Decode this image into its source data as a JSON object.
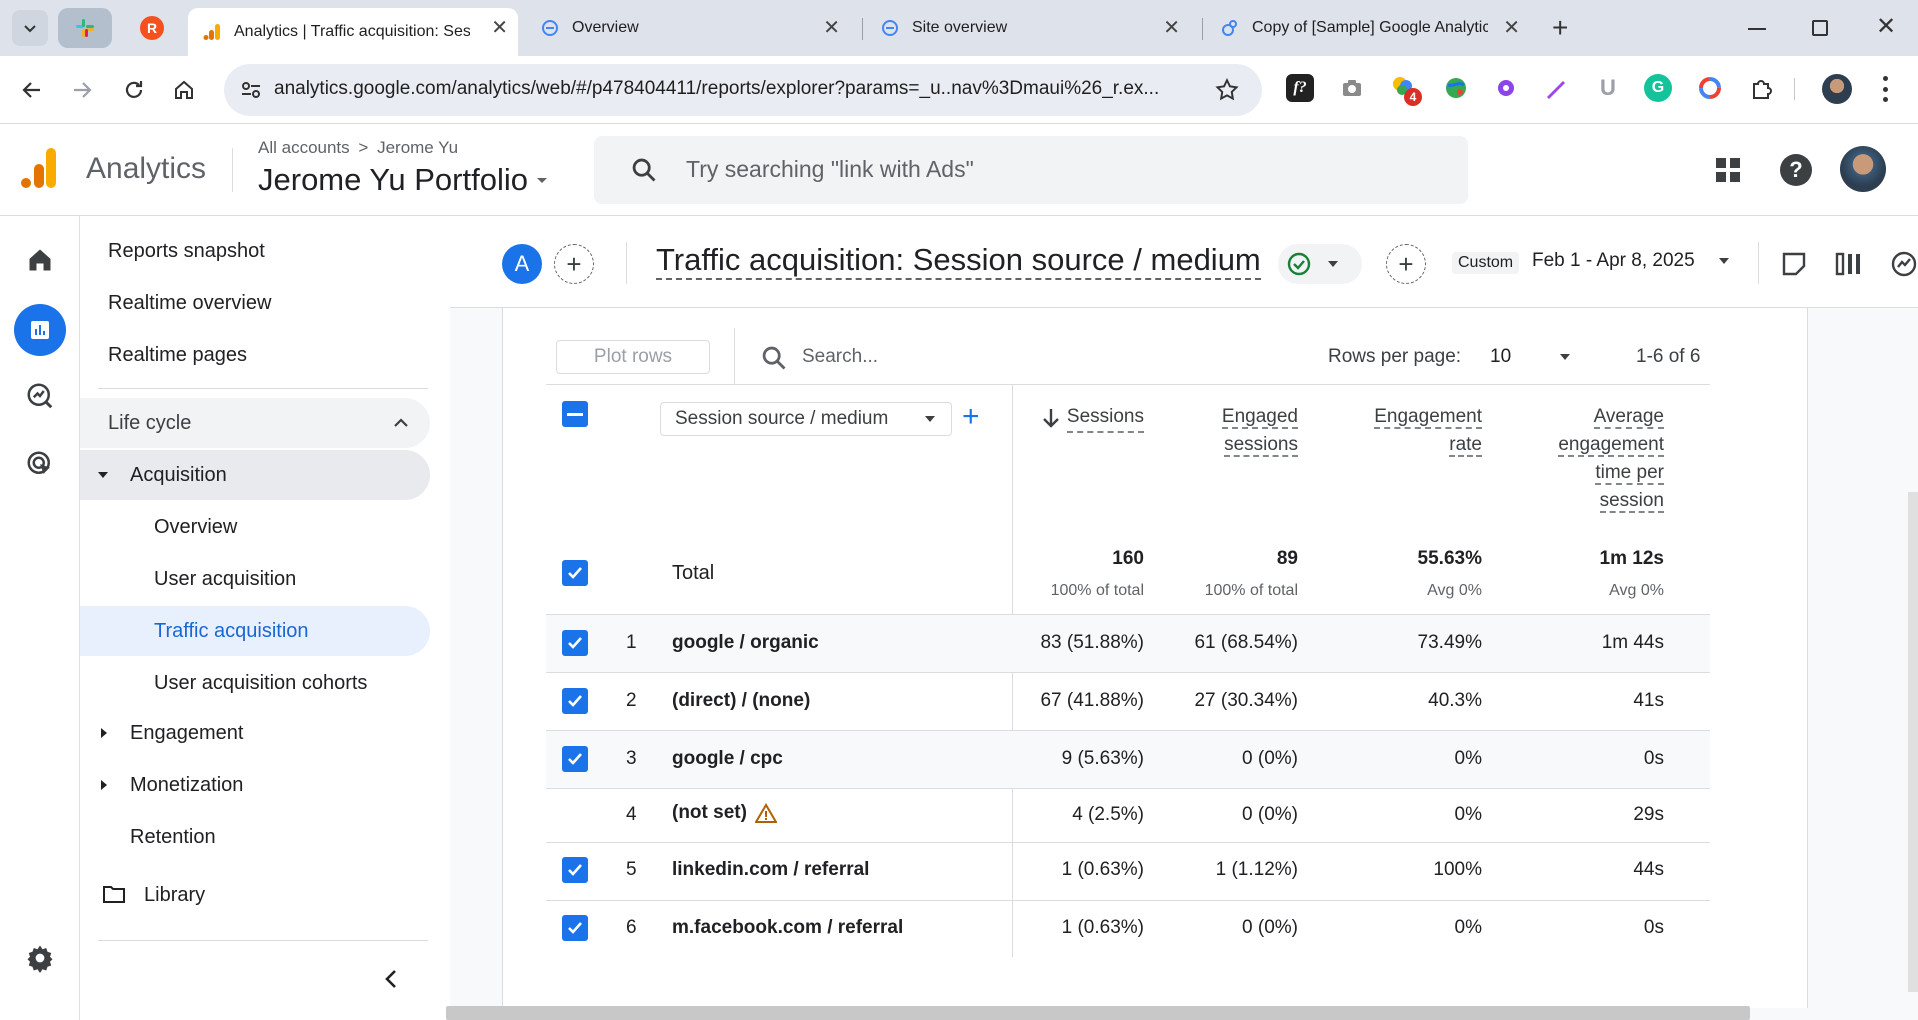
{
  "browser": {
    "tabs": [
      {
        "title": "Analytics | Traffic acquisition: Session source / medium",
        "active": true
      },
      {
        "title": "Overview",
        "active": false
      },
      {
        "title": "Site overview",
        "active": false
      },
      {
        "title": "Copy of [Sample] Google Analytics",
        "active": false
      }
    ],
    "url": "analytics.google.com/analytics/web/#/p478404411/reports/explorer?params=_u..nav%3Dmaui%26_r.ex...",
    "extension_badge": "4"
  },
  "header": {
    "product": "Analytics",
    "breadcrumb_all": "All accounts",
    "breadcrumb_sep": ">",
    "breadcrumb_account": "Jerome Yu",
    "property": "Jerome Yu Portfolio",
    "search_placeholder": "Try searching \"link with Ads\""
  },
  "nav": {
    "top": [
      "Reports snapshot",
      "Realtime overview",
      "Realtime pages"
    ],
    "lifecycle": "Life cycle",
    "acquisition": "Acquisition",
    "acquisition_items": [
      "Overview",
      "User acquisition",
      "Traffic acquisition",
      "User acquisition cohorts"
    ],
    "engagement": "Engagement",
    "monetization": "Monetization",
    "retention": "Retention",
    "library": "Library"
  },
  "report": {
    "avatar_letter": "A",
    "title": "Traffic acquisition: Session source / medium",
    "date_label": "Custom",
    "date_range": "Feb 1 - Apr 8, 2025"
  },
  "table": {
    "plot_rows": "Plot rows",
    "search_placeholder": "Search...",
    "rows_per_page_label": "Rows per page:",
    "rows_per_page": "10",
    "pagination": "1-6 of 6",
    "dimension": "Session source / medium",
    "columns": {
      "sessions": "Sessions",
      "engaged_1": "Engaged",
      "engaged_2": "sessions",
      "rate_1": "Engagement",
      "rate_2": "rate",
      "avg_1": "Average",
      "avg_2": "engagement",
      "avg_3": "time per",
      "avg_4": "session"
    },
    "total": {
      "label": "Total",
      "sessions": "160",
      "sessions_sub": "100% of total",
      "engaged": "89",
      "engaged_sub": "100% of total",
      "rate": "55.63%",
      "rate_sub": "Avg 0%",
      "avg": "1m 12s",
      "avg_sub": "Avg 0%"
    },
    "rows": [
      {
        "n": "1",
        "name": "google / organic",
        "sessions": "83 (51.88%)",
        "engaged": "61 (68.54%)",
        "rate": "73.49%",
        "avg": "1m 44s"
      },
      {
        "n": "2",
        "name": "(direct) / (none)",
        "sessions": "67 (41.88%)",
        "engaged": "27 (30.34%)",
        "rate": "40.3%",
        "avg": "41s"
      },
      {
        "n": "3",
        "name": "google / cpc",
        "sessions": "9 (5.63%)",
        "engaged": "0 (0%)",
        "rate": "0%",
        "avg": "0s"
      },
      {
        "n": "4",
        "name": "(not set)",
        "sessions": "4 (2.5%)",
        "engaged": "0 (0%)",
        "rate": "0%",
        "avg": "29s"
      },
      {
        "n": "5",
        "name": "linkedin.com / referral",
        "sessions": "1 (0.63%)",
        "engaged": "1 (1.12%)",
        "rate": "100%",
        "avg": "44s"
      },
      {
        "n": "6",
        "name": "m.facebook.com / referral",
        "sessions": "1 (0.63%)",
        "engaged": "0 (0%)",
        "rate": "0%",
        "avg": "0s"
      }
    ]
  },
  "colors": {
    "accent": "#1a73e8",
    "logo_orange": "#f9ab00",
    "logo_dark": "#e37400",
    "selected_bg": "#e8f0fe"
  }
}
